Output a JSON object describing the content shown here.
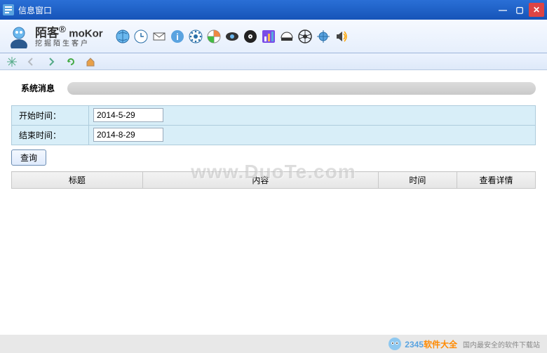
{
  "window": {
    "title": "信息窗口"
  },
  "brand": {
    "cn_name": "陌客",
    "en_name": "moKor",
    "slogan": "挖掘陌生客户"
  },
  "form": {
    "start_label": "开始时间：",
    "start_value": "2014-5-29",
    "end_label": "结束时间：",
    "end_value": "2014-8-29",
    "query_btn": "查询"
  },
  "panel": {
    "title": "系统消息"
  },
  "table": {
    "cols": [
      "标题",
      "内容",
      "时间",
      "查看详情"
    ]
  },
  "watermark": "www.DuoTe.com",
  "footer": {
    "brand_num": "2345",
    "brand_cn": "软件大全",
    "sub": "国内最安全的软件下载站"
  }
}
